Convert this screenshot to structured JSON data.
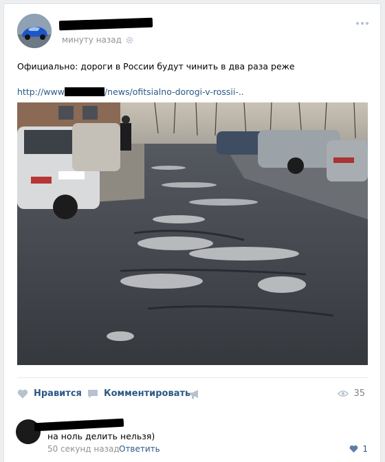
{
  "post": {
    "time": "минуту назад",
    "text": "Официально: дороги в России будут чинить в два раза реже",
    "link_prefix": "http://www",
    "link_suffix": "/news/ofitsialno-dorogi-v-rossii-.."
  },
  "actions": {
    "like_label": "Нравится",
    "comment_label": "Комментировать",
    "views": "35"
  },
  "comment": {
    "text": "на ноль делить нельзя)",
    "time": "50 секунд назад",
    "reply_label": "Ответить",
    "likes": "1"
  },
  "colors": {
    "link": "#2a5885",
    "muted": "#939393",
    "icon": "#b7c2cf"
  }
}
